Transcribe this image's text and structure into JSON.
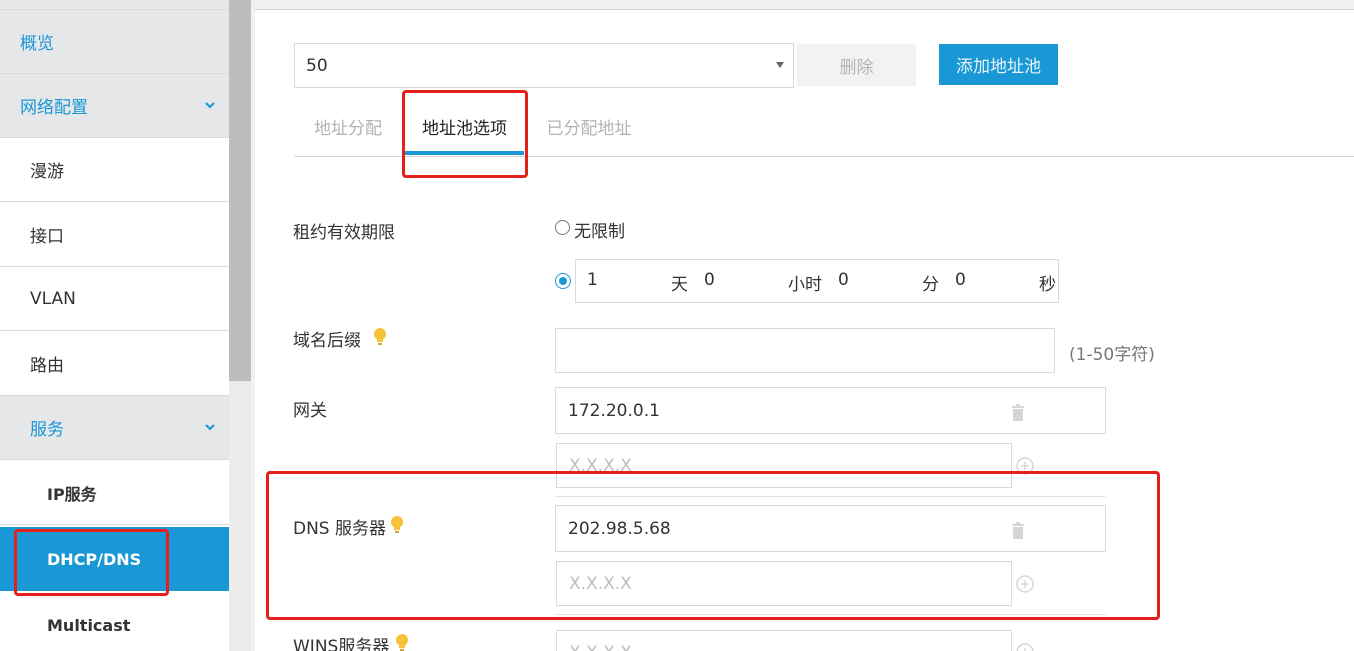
{
  "sidebar": {
    "items": [
      {
        "label": "概览"
      },
      {
        "label": "网络配置"
      },
      {
        "label": "漫游"
      },
      {
        "label": "接口"
      },
      {
        "label": "VLAN"
      },
      {
        "label": "路由"
      },
      {
        "label": "服务"
      },
      {
        "label": "IP服务"
      },
      {
        "label": "DHCP/DNS"
      },
      {
        "label": "Multicast"
      }
    ],
    "active_item": "DHCP/DNS",
    "accent_color": "#1a97d5"
  },
  "toolbar": {
    "pool_select": {
      "value": "50"
    },
    "delete_label": "删除",
    "add_pool_label": "添加地址池"
  },
  "tabs": [
    {
      "label": "地址分配"
    },
    {
      "label": "地址池选项",
      "active": true
    },
    {
      "label": "已分配地址"
    }
  ],
  "form": {
    "lease": {
      "label": "租约有效期限",
      "unlimited_label": "无限制",
      "selected": "duration",
      "days": "1",
      "days_unit": "天",
      "hours": "0",
      "hours_unit": "小时",
      "minutes": "0",
      "minutes_unit": "分",
      "seconds": "0",
      "seconds_unit": "秒"
    },
    "domain_suffix": {
      "label": "域名后缀",
      "value": "",
      "hint": "(1-50字符)"
    },
    "gateway": {
      "label": "网关",
      "value": "172.20.0.1",
      "placeholder": "X.X.X.X"
    },
    "dns": {
      "label": "DNS 服务器",
      "value": "202.98.5.68",
      "placeholder": "X.X.X.X"
    },
    "wins": {
      "label": "WINS服务器",
      "placeholder": "X.X.X.X"
    }
  },
  "icons": [
    "chevron-down-icon",
    "bulb-icon",
    "trash-icon",
    "plus-circle-icon",
    "dropdown-caret-icon"
  ]
}
